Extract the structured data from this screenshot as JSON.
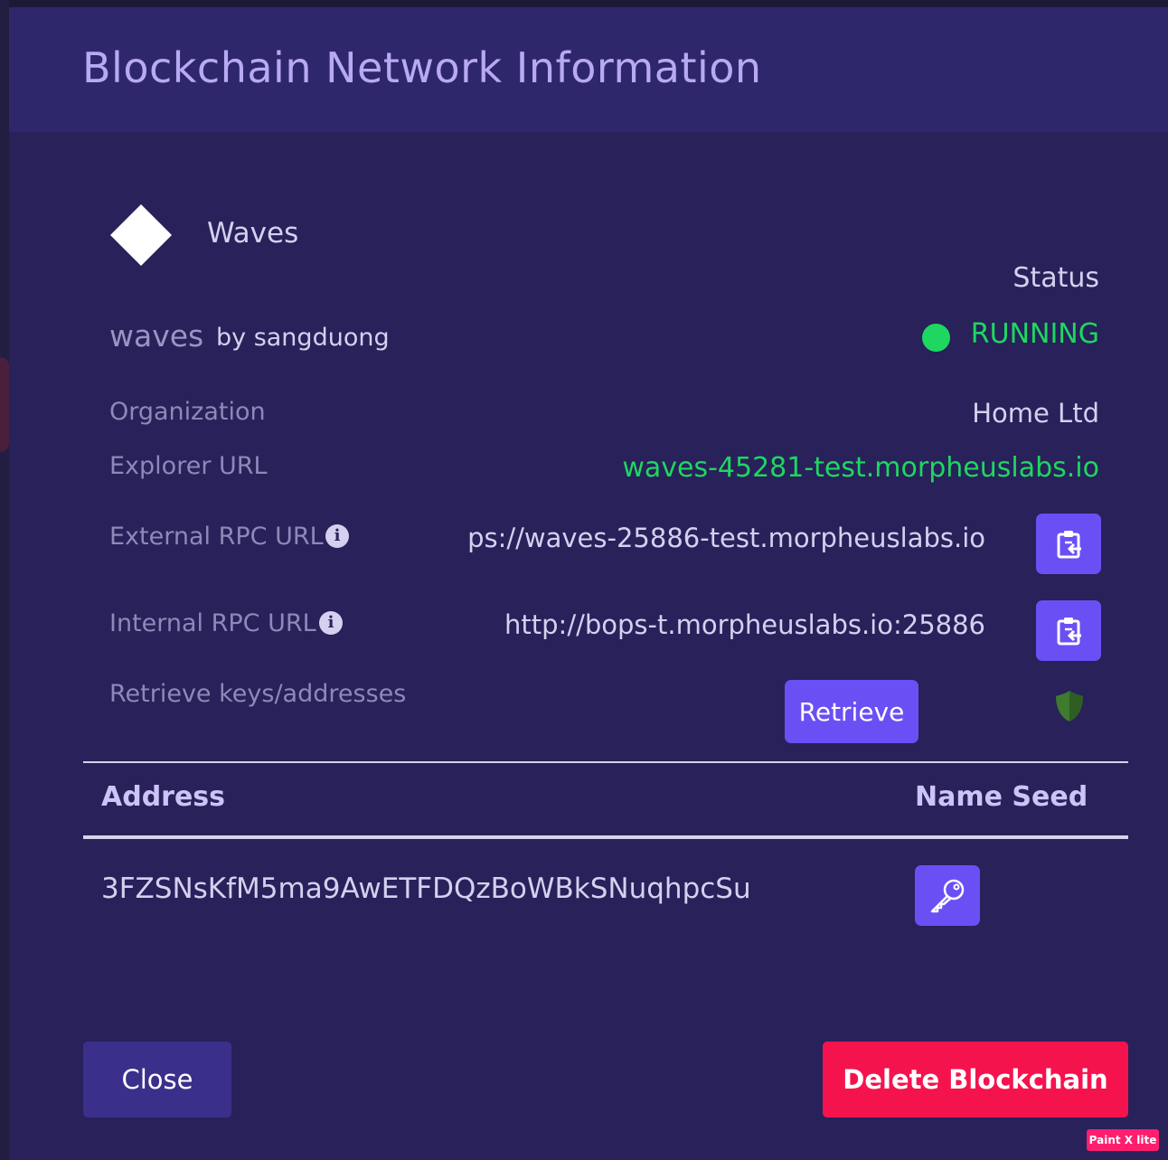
{
  "modal": {
    "title": "Blockchain Network Information"
  },
  "network": {
    "platform_name": "Waves",
    "chain_id": "waves",
    "owner": "by sangduong",
    "logo_icon": "diamond-icon"
  },
  "status": {
    "label": "Status",
    "value": "RUNNING",
    "color": "#1ed760"
  },
  "fields": {
    "organization_label": "Organization",
    "organization_value": "Home Ltd",
    "explorer_label": "Explorer URL",
    "explorer_value": "waves-45281-test.morpheuslabs.io",
    "external_rpc_label": "External RPC URL",
    "external_rpc_value": "ps://waves-25886-test.morpheuslabs.io",
    "internal_rpc_label": "Internal RPC URL",
    "internal_rpc_value": "http://bops-t.morpheuslabs.io:25886",
    "retrieve_label": "Retrieve keys/addresses",
    "retrieve_button": "Retrieve"
  },
  "table": {
    "headers": [
      "Address",
      "Name Seed"
    ],
    "rows": [
      {
        "address": "3FZSNsKfM5ma9AwETFDQzBoWBkSNuqhpcSu"
      }
    ]
  },
  "footer": {
    "close_label": "Close",
    "delete_label": "Delete Blockchain"
  },
  "colors": {
    "accent": "#6a4ff5",
    "danger": "#f5134e",
    "background": "#28215a",
    "header": "#2f276c"
  },
  "watermark": "Paint X lite"
}
